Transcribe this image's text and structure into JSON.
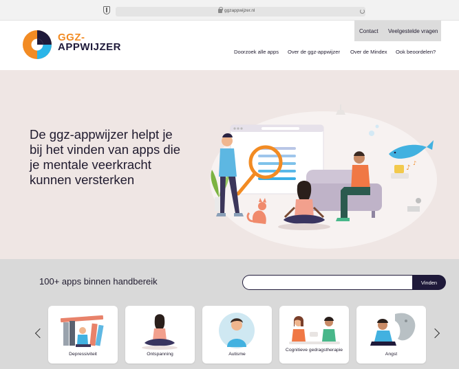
{
  "browser": {
    "url": "ggzappwijzer.nl"
  },
  "header": {
    "logo_line1": "GGZ-",
    "logo_line2": "APPWIJZER",
    "top_links": [
      "Contact",
      "Veelgestelde vragen"
    ],
    "nav": [
      "Doorzoek alle apps",
      "Over de ggz-appwijzer",
      "Over de Mindex",
      "Ook beoordelen?"
    ]
  },
  "hero": {
    "title": "De ggz-appwijzer helpt je bij het vinden van apps die je mentale veerkracht kunnen versterken"
  },
  "search": {
    "heading": "100+ apps binnen handbereik",
    "placeholder": "",
    "button": "Vinden"
  },
  "categories": [
    {
      "label": "Depressiviteit",
      "icon": "books-person-icon"
    },
    {
      "label": "Ontspanning",
      "icon": "meditating-person-icon"
    },
    {
      "label": "Autisme",
      "icon": "person-portrait-icon"
    },
    {
      "label": "Cognitieve gedragstherapie",
      "icon": "two-people-talking-icon"
    },
    {
      "label": "Angst",
      "icon": "anxious-person-icon"
    }
  ],
  "colors": {
    "brand_orange": "#f28b23",
    "brand_navy": "#1f1a3a",
    "brand_blue": "#2bb5e8",
    "hero_bg": "#efe6e4",
    "section_bg": "#d9d9d9"
  }
}
